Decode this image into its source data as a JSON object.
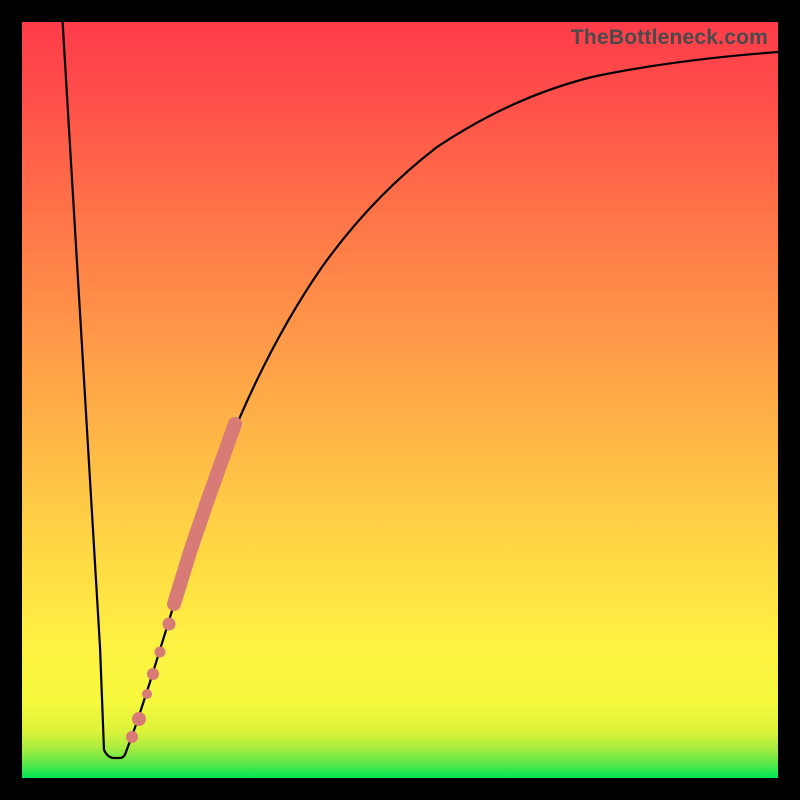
{
  "watermark": "TheBottleneck.com",
  "colors": {
    "frame": "#000000",
    "curve": "#000000",
    "highlight": "#d87b77"
  },
  "chart_data": {
    "type": "line",
    "title": "",
    "xlabel": "",
    "ylabel": "",
    "xlim": [
      0,
      100
    ],
    "ylim": [
      0,
      100
    ],
    "grid": false,
    "x": [
      0,
      5,
      8,
      10,
      11,
      12,
      14,
      16,
      18,
      20,
      22,
      25,
      28,
      32,
      36,
      40,
      45,
      50,
      55,
      60,
      65,
      70,
      75,
      80,
      85,
      90,
      95,
      100
    ],
    "y": [
      100,
      50,
      15,
      3,
      2,
      2,
      4,
      10,
      16,
      24,
      32,
      40,
      48,
      56,
      62,
      68,
      74,
      78,
      81,
      84,
      86,
      88,
      89.5,
      91,
      92,
      93,
      94,
      95
    ],
    "annotations": [
      {
        "type": "thick_segment",
        "x_range": [
          19,
          28
        ],
        "note": "highlighted thick dashed salmon segment on rising branch"
      },
      {
        "type": "dots",
        "x_points": [
          14,
          15,
          17,
          18.5
        ],
        "note": "individual salmon dots on lower rising portion"
      }
    ]
  }
}
